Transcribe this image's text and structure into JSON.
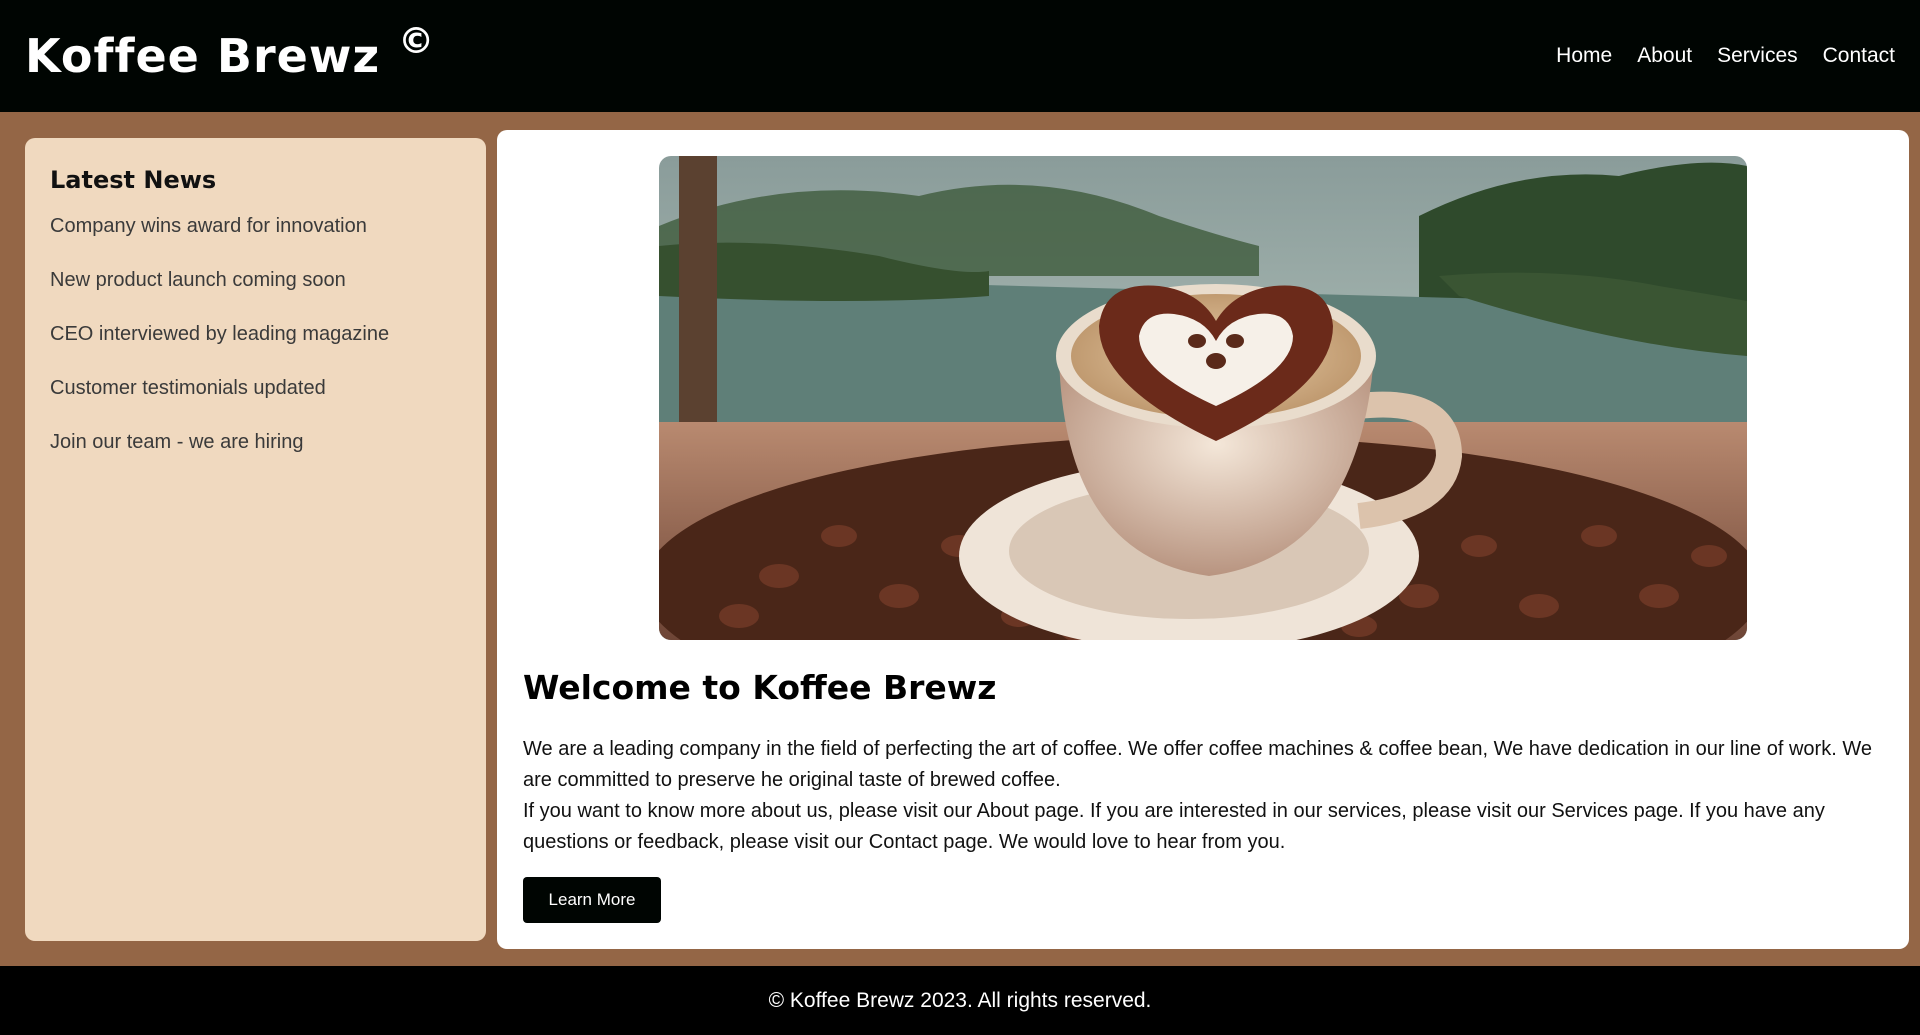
{
  "header": {
    "brand": "Koffee Brewz",
    "brand_mark": "©",
    "nav": [
      "Home",
      "About",
      "Services",
      "Contact"
    ]
  },
  "sidebar": {
    "title": "Latest News",
    "items": [
      "Company wins award for innovation",
      "New product launch coming soon",
      "CEO interviewed by leading magazine",
      "Customer testimonials updated",
      "Join our team - we are hiring"
    ]
  },
  "main": {
    "hero_image": "coffee-cup-heart-latte-art-over-lake",
    "title": "Welcome to Koffee Brewz",
    "paragraph_1": "We are a leading company in the field of perfecting the art of coffee. We offer coffee machines & coffee bean, We have dedication in our line of work. We are committed to preserve he original taste of brewed coffee.",
    "paragraph_2": "If you want to know more about us, please visit our About page. If you are interested in our services, please visit our Services page. If you have any questions or feedback, please visit our Contact page. We would love to hear from you.",
    "button": "Learn More"
  },
  "footer": {
    "text": "© Koffee Brewz 2023. All rights reserved."
  },
  "colors": {
    "header_bg": "#000502",
    "page_bg": "#946646",
    "sidebar_bg": "#f0d9bf",
    "main_bg": "#ffffff"
  }
}
